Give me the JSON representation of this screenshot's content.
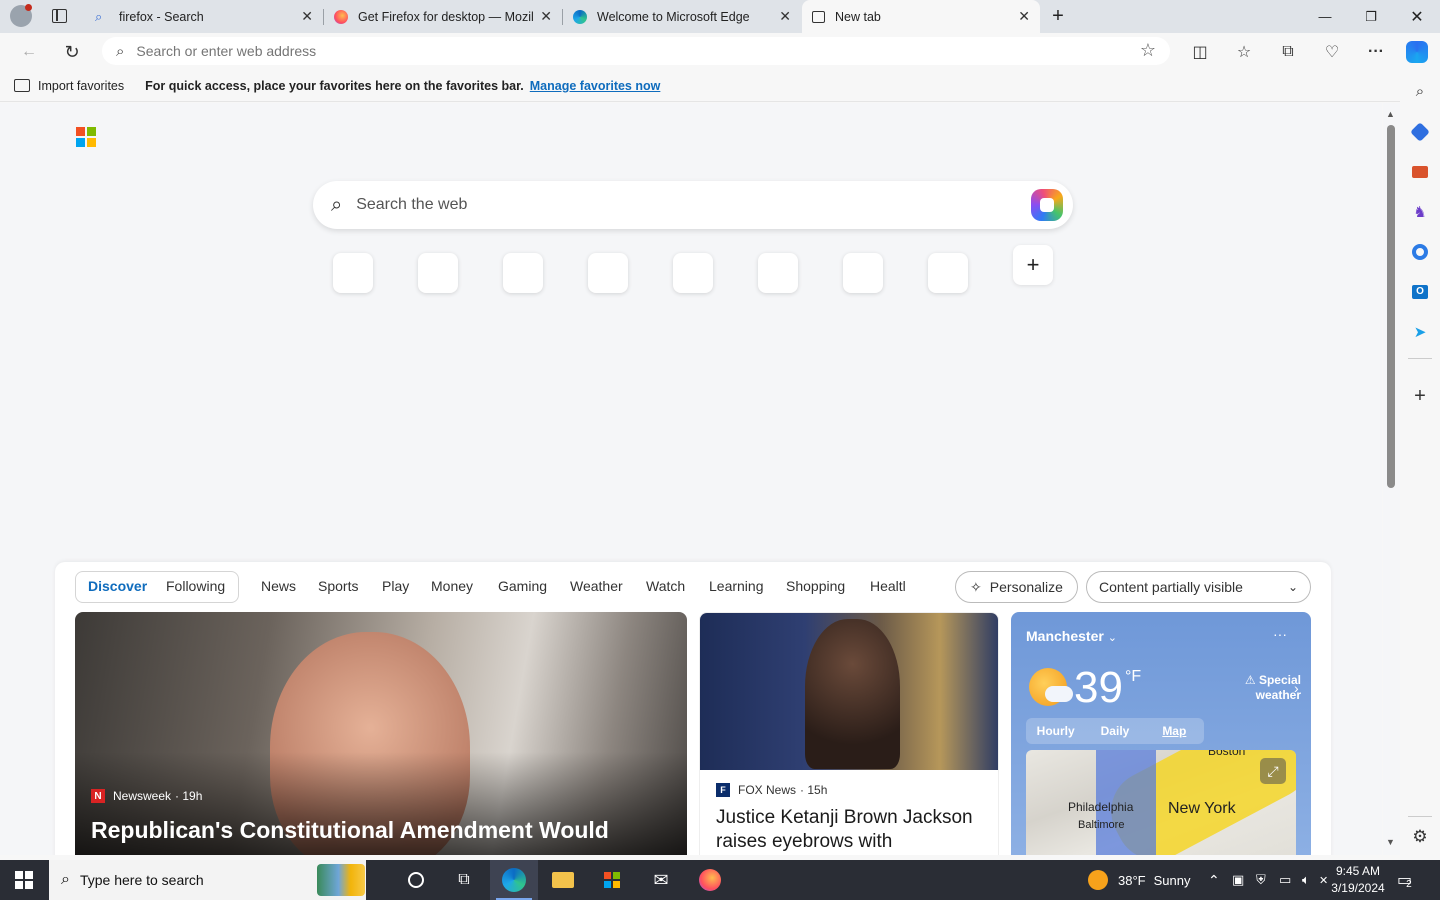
{
  "tabs": [
    {
      "title": "firefox - Search",
      "icon": "search-icon"
    },
    {
      "title": "Get Firefox for desktop — Mozill",
      "icon": "firefox-icon"
    },
    {
      "title": "Welcome to Microsoft Edge",
      "icon": "edge-icon"
    },
    {
      "title": "New tab",
      "icon": "new-tab-page-icon"
    }
  ],
  "address_bar": {
    "placeholder": "Search or enter web address"
  },
  "favorites_bar": {
    "import_label": "Import favorites",
    "message": "For quick access, place your favorites here on the favorites bar.",
    "manage_link": "Manage favorites now"
  },
  "new_tab": {
    "search_placeholder": "Search the web",
    "quick_link_count": 8
  },
  "feed": {
    "tabs": [
      "Discover",
      "Following",
      "News",
      "Sports",
      "Play",
      "Money",
      "Gaming",
      "Weather",
      "Watch",
      "Learning",
      "Shopping",
      "Healtl"
    ],
    "selected_tab": "Discover",
    "personalize_label": "Personalize",
    "visibility_label": "Content partially visible",
    "main_story": {
      "source": "Newsweek",
      "age": "· 19h",
      "title": "Republican's Constitutional Amendment Would"
    },
    "second_story": {
      "source": "FOX News",
      "age": "· 15h",
      "title": "Justice Ketanji Brown Jackson raises eyebrows with"
    },
    "weather": {
      "city": "Manchester",
      "temp": "39",
      "unit": "°F",
      "alert": "Special weather",
      "tabs": [
        "Hourly",
        "Daily",
        "Map"
      ],
      "selected_tab": "Map",
      "map_labels": [
        "Philadelphia",
        "Baltimore",
        "New York",
        "Boston"
      ]
    }
  },
  "taskbar": {
    "search_placeholder": "Type here to search",
    "weather": "38°F",
    "weather_desc": "Sunny",
    "time": "9:45 AM",
    "date": "3/19/2024",
    "notification_count": "2"
  },
  "colors": {
    "accent": "#0f6cbd",
    "tabstrip": "#dfe3e8",
    "taskbar": "#2a2d35"
  }
}
